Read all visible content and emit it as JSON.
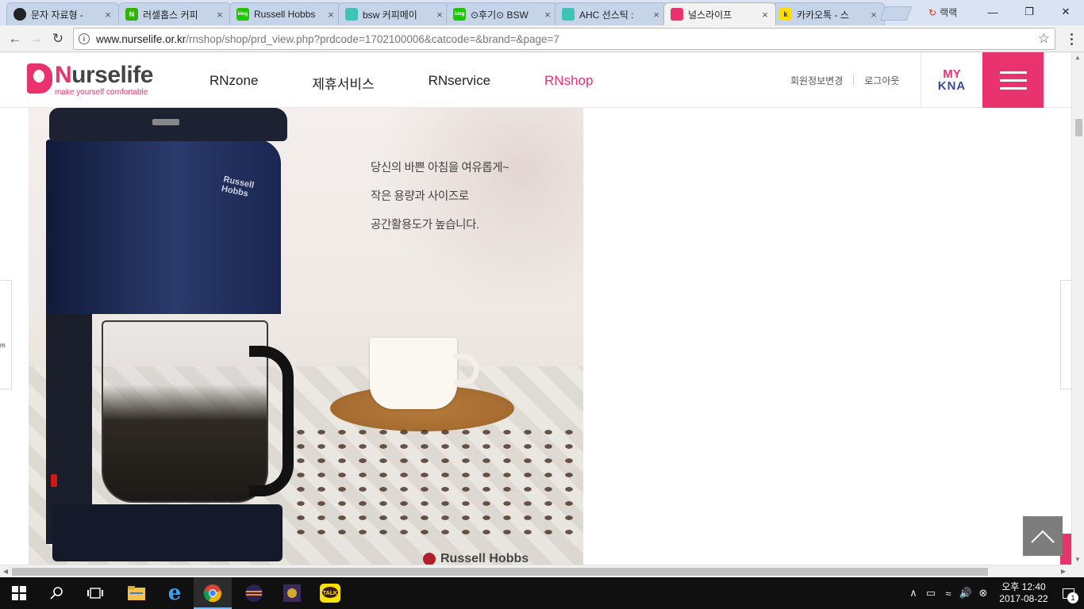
{
  "browser": {
    "tabs": [
      {
        "title": "문자 자료형 - ",
        "fav_color": "#222222",
        "fav_glyph": ""
      },
      {
        "title": "러셀홉스 커피",
        "fav_color": "#2db400",
        "fav_glyph": "N"
      },
      {
        "title": "Russell Hobbs",
        "fav_color": "#1ec800",
        "fav_glyph": "blog"
      },
      {
        "title": "bsw 커피메이",
        "fav_color": "#3ec4b4",
        "fav_glyph": ""
      },
      {
        "title": "⊙후기⊙ BSW",
        "fav_color": "#1ec800",
        "fav_glyph": "blog"
      },
      {
        "title": "AHC 선스틱 :",
        "fav_color": "#3ec4b4",
        "fav_glyph": ""
      },
      {
        "title": "널스라이프",
        "fav_color": "#e8336e",
        "fav_glyph": ""
      },
      {
        "title": "카카오톡 - 스",
        "fav_color": "#f9e000",
        "fav_glyph": "k"
      }
    ],
    "active_tab": 6,
    "close_glyph": "×",
    "profile_name": "랙랙",
    "url_host": "www.nurselife.or.kr",
    "url_path": "/rnshop/shop/prd_view.php?prdcode=1702100006&catcode=&brand=&page=7"
  },
  "site": {
    "logo_n": "N",
    "logo_rest": "urselife",
    "tagline": "make yourself comfortable",
    "nav": [
      "RNzone",
      "제휴서비스",
      "RNservice",
      "RNshop"
    ],
    "active_nav": "RNshop",
    "util_links": [
      "회원정보변경",
      "로그아웃"
    ],
    "myk_top": "MY",
    "myk_bottom": "KNA",
    "accent_color": "#e8336e"
  },
  "product_banner": {
    "promo_lines": [
      "당신의 바쁜 아침을 여유롭게~",
      "작은 용량과 사이즈로",
      "공간활용도가 높습니다."
    ],
    "brand_on_machine": [
      "Russell",
      "Hobbs"
    ],
    "bottom_brand": "Russell Hobbs"
  },
  "side_tab_text": "m",
  "taskbar": {
    "time": "오후 12:40",
    "date": "2017-08-22",
    "notification_count": "1"
  }
}
